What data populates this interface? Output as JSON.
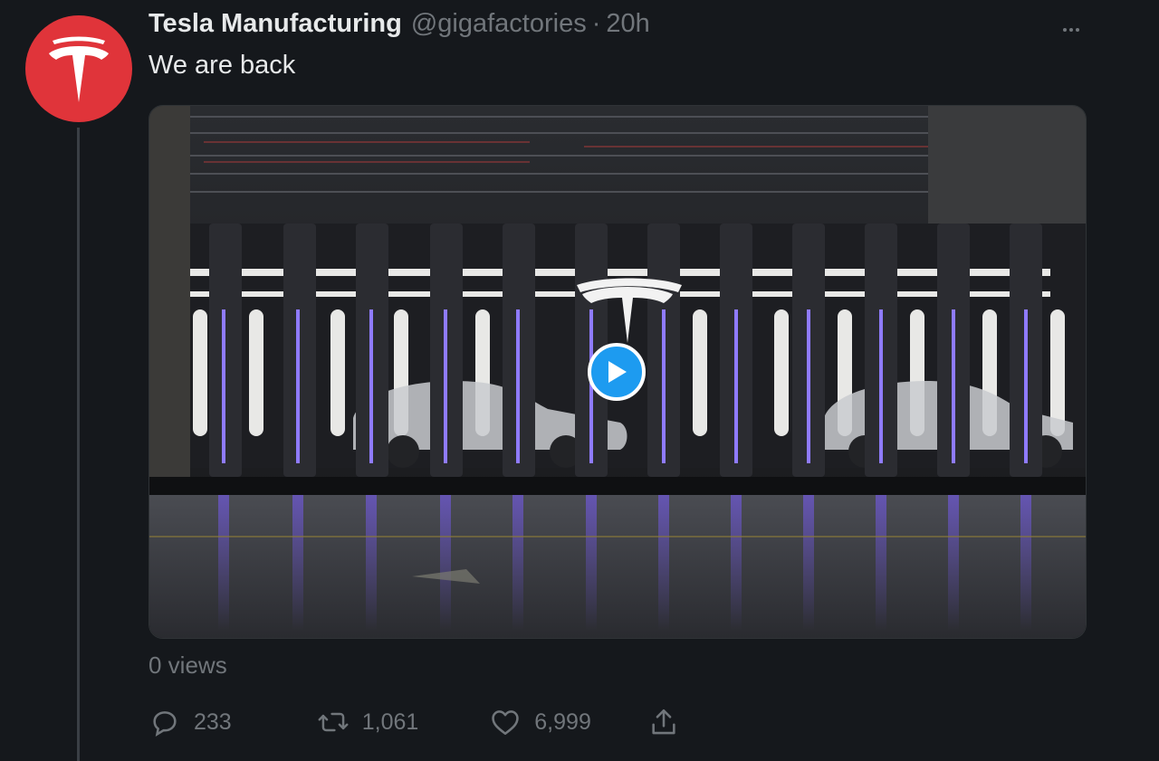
{
  "tweet": {
    "author_name": "Tesla Manufacturing",
    "handle": "@gigafactories",
    "separator": "·",
    "time": "20h",
    "text": "We are back",
    "views": "0 views"
  },
  "avatar": {
    "icon": "tesla-logo-icon",
    "color": "#e0343a"
  },
  "media": {
    "type": "video",
    "description_icon": "play-icon",
    "accent": "#1d9bf0"
  },
  "actions": {
    "reply": {
      "icon": "reply-icon",
      "count": "233"
    },
    "retweet": {
      "icon": "retweet-icon",
      "count": "1,061"
    },
    "like": {
      "icon": "heart-icon",
      "count": "6,999"
    },
    "share": {
      "icon": "share-icon"
    }
  },
  "more_menu": {
    "icon": "more-icon"
  }
}
